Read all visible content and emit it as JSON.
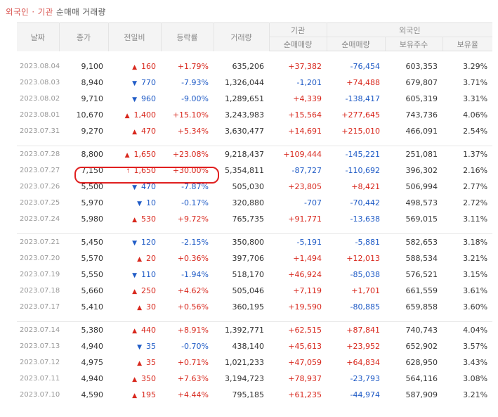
{
  "title": {
    "highlight": "외국인 · 기관",
    "rest": "순매매 거래량"
  },
  "headers": {
    "date": "날짜",
    "close": "종가",
    "change": "전일비",
    "rate": "등락률",
    "volume": "거래량",
    "inst": "기관",
    "foreign": "외국인",
    "inst_net": "순매매량",
    "foreign_net": "순매매량",
    "foreign_hold": "보유주수",
    "foreign_ratio": "보유율"
  },
  "groups": [
    [
      {
        "date": "2023.08.04",
        "close": "9,100",
        "dir": "up",
        "chg": "160",
        "rate": "+1.79%",
        "vol": "635,206",
        "inst": "+37,382",
        "frn": "-76,454",
        "hold": "603,353",
        "ratio": "3.29%"
      },
      {
        "date": "2023.08.03",
        "close": "8,940",
        "dir": "down",
        "chg": "770",
        "rate": "-7.93%",
        "vol": "1,326,044",
        "inst": "-1,201",
        "frn": "+74,488",
        "hold": "679,807",
        "ratio": "3.71%"
      },
      {
        "date": "2023.08.02",
        "close": "9,710",
        "dir": "down",
        "chg": "960",
        "rate": "-9.00%",
        "vol": "1,289,651",
        "inst": "+4,339",
        "frn": "-138,417",
        "hold": "605,319",
        "ratio": "3.31%"
      },
      {
        "date": "2023.08.01",
        "close": "10,670",
        "dir": "up",
        "chg": "1,400",
        "rate": "+15.10%",
        "vol": "3,243,983",
        "inst": "+15,564",
        "frn": "+277,645",
        "hold": "743,736",
        "ratio": "4.06%"
      },
      {
        "date": "2023.07.31",
        "close": "9,270",
        "dir": "up",
        "chg": "470",
        "rate": "+5.34%",
        "vol": "3,630,477",
        "inst": "+14,691",
        "frn": "+215,010",
        "hold": "466,091",
        "ratio": "2.54%"
      }
    ],
    [
      {
        "date": "2023.07.28",
        "close": "8,800",
        "dir": "up",
        "chg": "1,650",
        "rate": "+23.08%",
        "vol": "9,218,437",
        "inst": "+109,444",
        "frn": "-145,221",
        "hold": "251,081",
        "ratio": "1.37%"
      },
      {
        "date": "2023.07.27",
        "close": "7,150",
        "dir": "limit",
        "chg": "1,650",
        "rate": "+30.00%",
        "vol": "5,354,811",
        "inst": "-87,727",
        "frn": "-110,692",
        "hold": "396,302",
        "ratio": "2.16%"
      },
      {
        "date": "2023.07.26",
        "close": "5,500",
        "dir": "down",
        "chg": "470",
        "rate": "-7.87%",
        "vol": "505,030",
        "inst": "+23,805",
        "frn": "+8,421",
        "hold": "506,994",
        "ratio": "2.77%"
      },
      {
        "date": "2023.07.25",
        "close": "5,970",
        "dir": "down",
        "chg": "10",
        "rate": "-0.17%",
        "vol": "320,880",
        "inst": "-707",
        "frn": "-70,442",
        "hold": "498,573",
        "ratio": "2.72%"
      },
      {
        "date": "2023.07.24",
        "close": "5,980",
        "dir": "up",
        "chg": "530",
        "rate": "+9.72%",
        "vol": "765,735",
        "inst": "+91,771",
        "frn": "-13,638",
        "hold": "569,015",
        "ratio": "3.11%"
      }
    ],
    [
      {
        "date": "2023.07.21",
        "close": "5,450",
        "dir": "down",
        "chg": "120",
        "rate": "-2.15%",
        "vol": "350,800",
        "inst": "-5,191",
        "frn": "-5,881",
        "hold": "582,653",
        "ratio": "3.18%"
      },
      {
        "date": "2023.07.20",
        "close": "5,570",
        "dir": "up",
        "chg": "20",
        "rate": "+0.36%",
        "vol": "397,706",
        "inst": "+1,494",
        "frn": "+12,013",
        "hold": "588,534",
        "ratio": "3.21%"
      },
      {
        "date": "2023.07.19",
        "close": "5,550",
        "dir": "down",
        "chg": "110",
        "rate": "-1.94%",
        "vol": "518,170",
        "inst": "+46,924",
        "frn": "-85,038",
        "hold": "576,521",
        "ratio": "3.15%"
      },
      {
        "date": "2023.07.18",
        "close": "5,660",
        "dir": "up",
        "chg": "250",
        "rate": "+4.62%",
        "vol": "505,046",
        "inst": "+7,119",
        "frn": "+1,701",
        "hold": "661,559",
        "ratio": "3.61%"
      },
      {
        "date": "2023.07.17",
        "close": "5,410",
        "dir": "up",
        "chg": "30",
        "rate": "+0.56%",
        "vol": "360,195",
        "inst": "+19,590",
        "frn": "-80,885",
        "hold": "659,858",
        "ratio": "3.60%"
      }
    ],
    [
      {
        "date": "2023.07.14",
        "close": "5,380",
        "dir": "up",
        "chg": "440",
        "rate": "+8.91%",
        "vol": "1,392,771",
        "inst": "+62,515",
        "frn": "+87,841",
        "hold": "740,743",
        "ratio": "4.04%"
      },
      {
        "date": "2023.07.13",
        "close": "4,940",
        "dir": "down",
        "chg": "35",
        "rate": "-0.70%",
        "vol": "438,140",
        "inst": "+45,613",
        "frn": "+23,952",
        "hold": "652,902",
        "ratio": "3.57%"
      },
      {
        "date": "2023.07.12",
        "close": "4,975",
        "dir": "up",
        "chg": "35",
        "rate": "+0.71%",
        "vol": "1,021,233",
        "inst": "+47,059",
        "frn": "+64,834",
        "hold": "628,950",
        "ratio": "3.43%"
      },
      {
        "date": "2023.07.11",
        "close": "4,940",
        "dir": "up",
        "chg": "350",
        "rate": "+7.63%",
        "vol": "3,194,723",
        "inst": "+78,937",
        "frn": "-23,793",
        "hold": "564,116",
        "ratio": "3.08%"
      },
      {
        "date": "2023.07.10",
        "close": "4,590",
        "dir": "up",
        "chg": "195",
        "rate": "+4.44%",
        "vol": "795,185",
        "inst": "+61,235",
        "frn": "-44,974",
        "hold": "587,909",
        "ratio": "3.21%"
      }
    ]
  ],
  "icons": {
    "up": "triangle-up-icon",
    "down": "triangle-down-icon",
    "limit": "arrow-up-icon"
  },
  "colors": {
    "up": "#d8271c",
    "down": "#1f5bc6",
    "annotation": "#e02020"
  }
}
